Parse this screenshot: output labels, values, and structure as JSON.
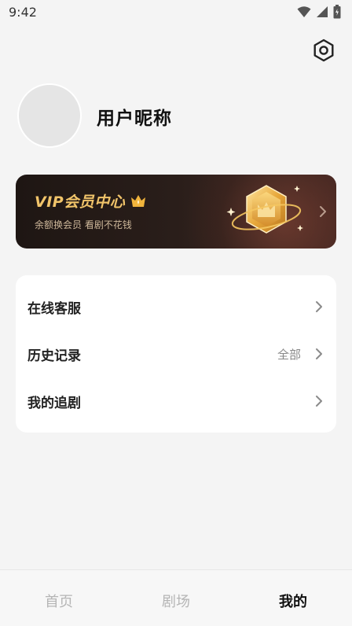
{
  "status_bar": {
    "time": "9:42",
    "icons": [
      "wifi-icon",
      "signal-icon",
      "battery-icon"
    ]
  },
  "header": {
    "settings_icon": "settings-icon"
  },
  "profile": {
    "nickname": "用户昵称"
  },
  "vip_banner": {
    "title": "VIP会员中心",
    "subtitle": "余额换会员 看剧不花钱",
    "crown_icon": "crown-icon",
    "badge_icon": "vip-crown-badge",
    "colors": {
      "title": "#f1c46a",
      "background": "#2a1e1a"
    }
  },
  "menu": {
    "items": [
      {
        "label": "在线客服",
        "extra": ""
      },
      {
        "label": "历史记录",
        "extra": "全部"
      },
      {
        "label": "我的追剧",
        "extra": ""
      }
    ]
  },
  "bottom_nav": {
    "items": [
      {
        "label": "首页",
        "active": false
      },
      {
        "label": "剧场",
        "active": false
      },
      {
        "label": "我的",
        "active": true
      }
    ]
  }
}
